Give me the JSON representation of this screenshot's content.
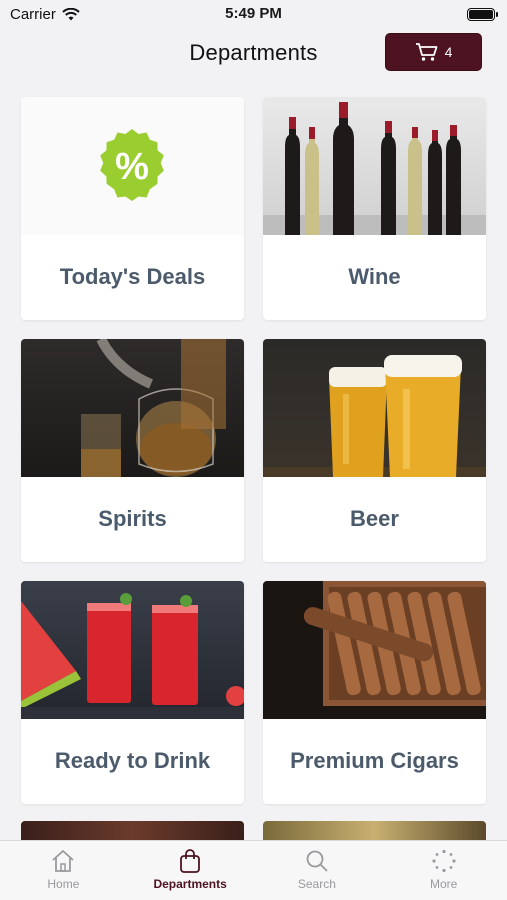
{
  "status": {
    "carrier": "Carrier",
    "time": "5:49 PM"
  },
  "header": {
    "title": "Departments",
    "cart_count": "4"
  },
  "departments": [
    {
      "label": "Today's Deals"
    },
    {
      "label": "Wine"
    },
    {
      "label": "Spirits"
    },
    {
      "label": "Beer"
    },
    {
      "label": "Ready to Drink"
    },
    {
      "label": "Premium Cigars"
    }
  ],
  "deals_badge": {
    "symbol": "%"
  },
  "tabs": [
    {
      "label": "Home",
      "icon": "home-icon"
    },
    {
      "label": "Departments",
      "icon": "bag-icon"
    },
    {
      "label": "Search",
      "icon": "search-icon"
    },
    {
      "label": "More",
      "icon": "more-icon"
    }
  ],
  "colors": {
    "brand": "#4e1320",
    "label_text": "#4c5b6c",
    "deals_badge": "#9acd2f",
    "tab_inactive": "#9a9a9e"
  }
}
